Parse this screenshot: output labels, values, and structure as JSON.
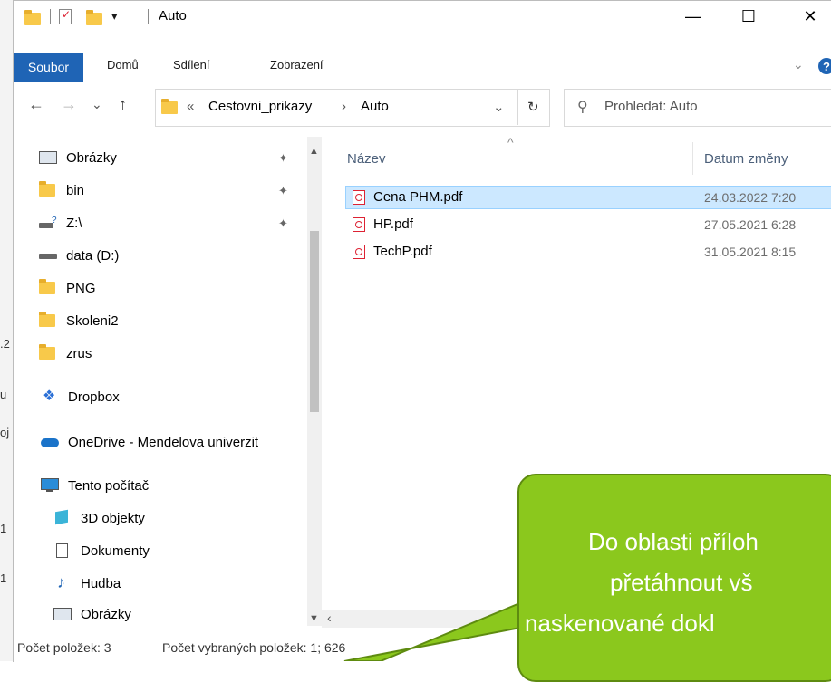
{
  "background_window": {
    "fragments": [
      ".2",
      "u",
      "oj",
      "1",
      "1"
    ]
  },
  "titlebar": {
    "title": "Auto",
    "minimize": "—",
    "maximize": "☐",
    "close": "✕"
  },
  "ribbon": {
    "tabs": [
      "Soubor",
      "Domů",
      "Sdílení",
      "Zobrazení"
    ],
    "expand": "⌄",
    "help": "?"
  },
  "address": {
    "back": "←",
    "forward": "→",
    "recent": "⌄",
    "up": "↑",
    "overflow": "«",
    "crumbs": [
      "Cestovni_prikazy",
      "Auto"
    ],
    "separator": "›",
    "dropdown": "⌄",
    "refresh": "↻",
    "search_placeholder": "Prohledat: Auto"
  },
  "navpane": {
    "items": [
      {
        "label": "Obrázky",
        "icon": "pictures-icon",
        "pinned": true
      },
      {
        "label": "bin",
        "icon": "folder-icon",
        "pinned": true
      },
      {
        "label": "Z:\\",
        "icon": "network-drive-icon",
        "pinned": true
      },
      {
        "label": "data (D:)",
        "icon": "drive-icon",
        "pinned": false
      },
      {
        "label": "PNG",
        "icon": "folder-icon",
        "pinned": false
      },
      {
        "label": "Skoleni2",
        "icon": "folder-icon",
        "pinned": false
      },
      {
        "label": "zrus",
        "icon": "folder-icon",
        "pinned": false
      },
      {
        "label": "Dropbox",
        "icon": "dropbox-icon",
        "pinned": false
      },
      {
        "label": "OneDrive - Mendelova univerzit",
        "icon": "onedrive-icon",
        "pinned": false
      },
      {
        "label": "Tento počítač",
        "icon": "computer-icon",
        "pinned": false
      },
      {
        "label": "3D objekty",
        "icon": "3d-objects-icon",
        "pinned": false
      },
      {
        "label": "Dokumenty",
        "icon": "documents-icon",
        "pinned": false
      },
      {
        "label": "Hudba",
        "icon": "music-icon",
        "pinned": false
      },
      {
        "label": "Obrázky",
        "icon": "pictures-icon",
        "pinned": false
      }
    ],
    "pin_glyph": "📌"
  },
  "filelist": {
    "columns": [
      "Název",
      "Datum změny"
    ],
    "sort_indicator": "^",
    "files": [
      {
        "name": "Cena PHM.pdf",
        "date": "24.03.2022 7:20",
        "selected": true
      },
      {
        "name": "HP.pdf",
        "date": "27.05.2021 6:28",
        "selected": false
      },
      {
        "name": "TechP.pdf",
        "date": "31.05.2021 8:15",
        "selected": false
      }
    ]
  },
  "statusbar": {
    "count": "Počet položek: 3",
    "selected": "Počet vybraných položek: 1; 626"
  },
  "callout": {
    "lines": [
      "Do oblasti příloh",
      "přetáhnout vš",
      "naskenované dokl"
    ]
  },
  "colors": {
    "accent": "#1f64b5",
    "callout": "#8bc81d",
    "selection": "#cce8ff"
  }
}
